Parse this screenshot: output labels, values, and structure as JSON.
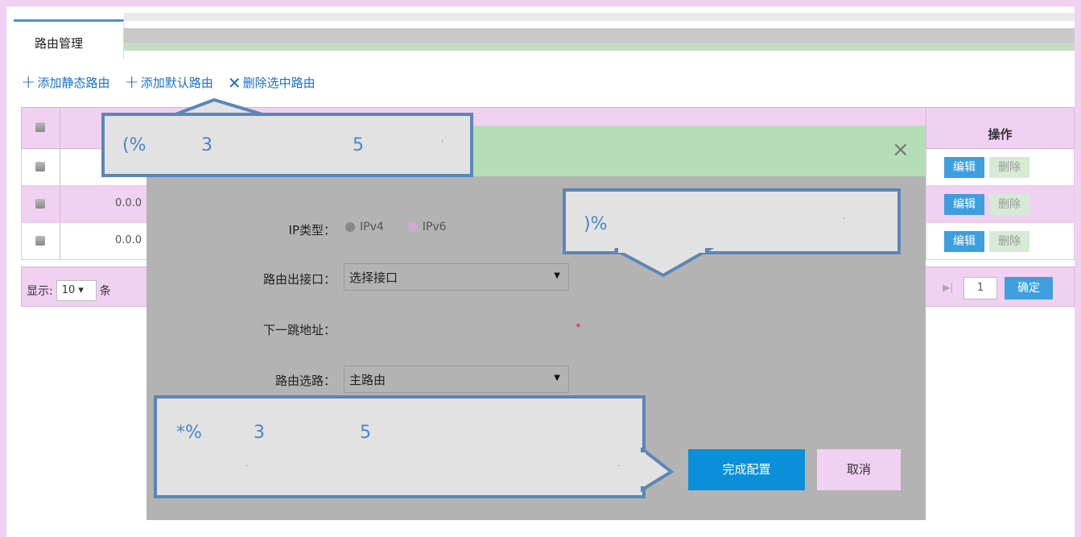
{
  "tab": {
    "label": "路由管理"
  },
  "toolbar": {
    "add_static": "添加静态路由",
    "add_default": "添加默认路由",
    "delete_selected": "删除选中路由"
  },
  "table": {
    "op_header": "操作",
    "rows": [
      {
        "ip": "",
        "edit": "编辑",
        "delete": "删除"
      },
      {
        "ip": "0.0.0",
        "edit": "编辑",
        "delete": "删除"
      },
      {
        "ip": "0.0.0",
        "edit": "编辑",
        "delete": "删除"
      }
    ],
    "pager": {
      "show_label": "显示:",
      "page_size": "10",
      "unit": "条",
      "page": "1",
      "confirm": "确定"
    }
  },
  "modal": {
    "close": "×",
    "ip_type_label": "IP类型：",
    "ip_options": [
      "IPv4",
      "IPv6"
    ],
    "iface_label": "路由出接口：",
    "iface_value": "选择接口",
    "next_hop_label": "下一跳地址：",
    "required_mark": "*",
    "route_label": "路由选路：",
    "route_value": "主路由",
    "done": "完成配置",
    "cancel": "取消"
  },
  "callouts": {
    "a": {
      "chars": [
        "(%",
        "3",
        "5",
        "."
      ]
    },
    "b": {
      "chars": [
        ")%",
        "."
      ]
    },
    "c": {
      "chars": [
        "*%",
        "3",
        "5",
        ".",
        "."
      ]
    }
  }
}
